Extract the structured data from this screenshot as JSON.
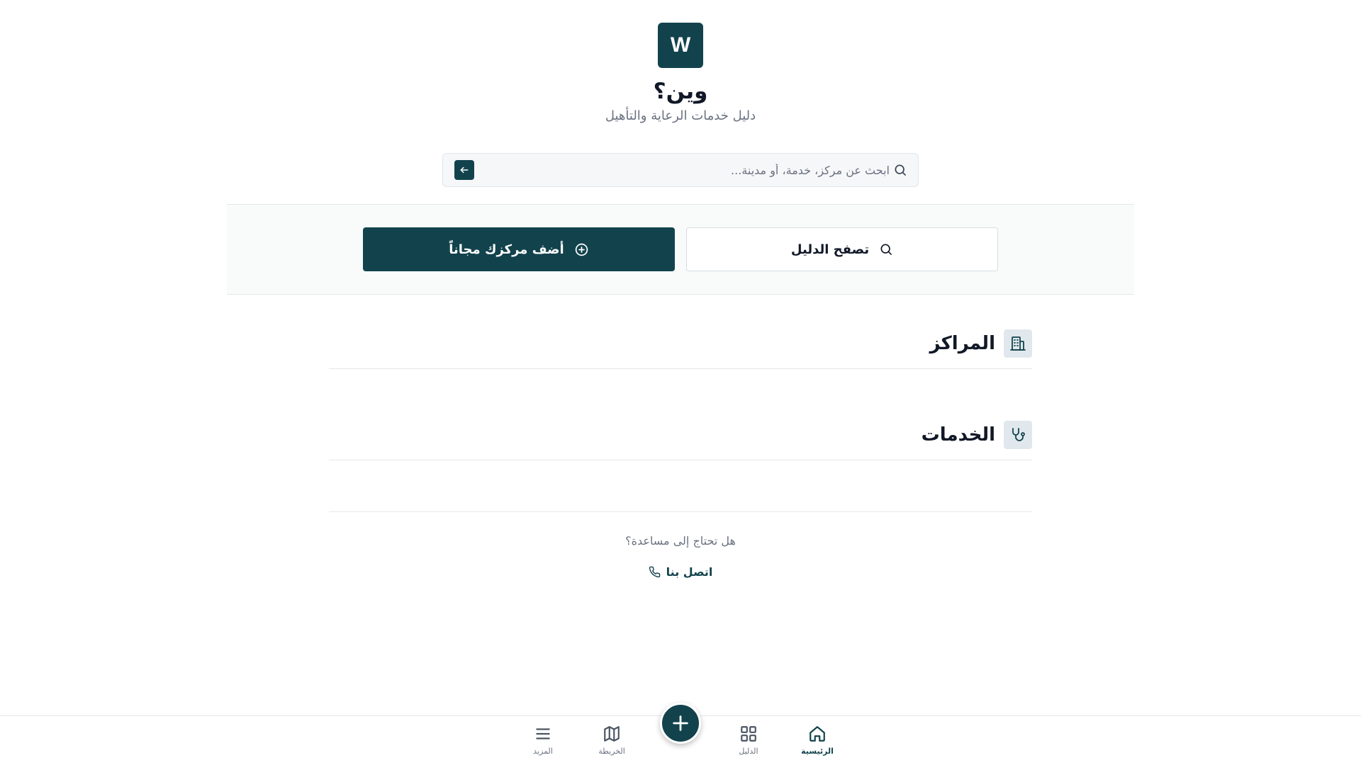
{
  "header": {
    "logo_letter": "W",
    "title": "وين؟",
    "subtitle": "دليل خدمات الرعاية والتأهيل"
  },
  "search": {
    "placeholder": "ابحث عن مركز، خدمة، أو مدينة..."
  },
  "actions": {
    "browse_label": "تصفح الدليل",
    "add_center_label": "أضف مركزك مجاناً"
  },
  "sections": {
    "centers_title": "المراكز",
    "services_title": "الخدمات"
  },
  "help": {
    "question": "هل تحتاج إلى مساعدة؟",
    "contact_label": "اتصل بنا"
  },
  "bottom_nav": {
    "home": "الرئيسية",
    "directory": "الدليل",
    "map": "الخريطة",
    "more": "المزيد"
  },
  "colors": {
    "primary": "#12434d",
    "muted_text": "#6b7280",
    "border": "#e5e7eb"
  },
  "icons": {
    "search": "search-icon",
    "submit": "arrow-left-icon",
    "add": "plus-circle-icon",
    "centers": "building-icon",
    "services": "stethoscope-icon",
    "phone": "phone-icon",
    "home": "home-icon",
    "directory": "grid-icon",
    "map": "map-icon",
    "more": "menu-icon",
    "fab": "plus-icon"
  }
}
